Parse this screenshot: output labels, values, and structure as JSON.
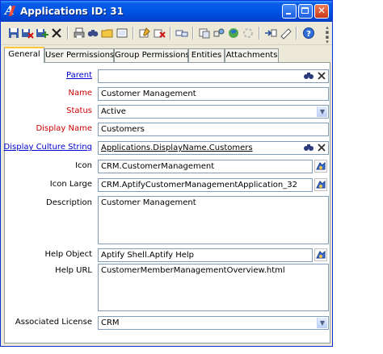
{
  "window": {
    "title": "Applications ID: 31"
  },
  "title_buttons": {
    "minimize": "minimize-button",
    "maximize": "maximize-button",
    "close": "close-button"
  },
  "toolbar": {
    "icons": [
      "save-icon",
      "save-and-close-icon",
      "save-and-new-icon",
      "delete-icon",
      "print-icon",
      "find-icon",
      "open-folder-icon",
      "copy-icon",
      "note-icon",
      "clear-icon",
      "link-icon",
      "attach-icon",
      "workflow-icon",
      "web-icon",
      "spinner-icon",
      "import-icon",
      "export-icon",
      "help-icon",
      "grip-icon"
    ]
  },
  "tabs": [
    {
      "label": "General",
      "active": true
    },
    {
      "label": "User Permissions",
      "active": false
    },
    {
      "label": "Group Permissions",
      "active": false
    },
    {
      "label": "Entities",
      "active": false
    },
    {
      "label": "Attachments",
      "active": false
    }
  ],
  "form": {
    "parent": {
      "label": "Parent",
      "value": ""
    },
    "name": {
      "label": "Name",
      "value": "Customer Management"
    },
    "status": {
      "label": "Status",
      "value": "Active"
    },
    "display_name": {
      "label": "Display Name",
      "value": "Customers"
    },
    "display_culture_string": {
      "label": "Display Culture String",
      "value": "Applications.DisplayName.Customers"
    },
    "icon": {
      "label": "Icon",
      "value": "CRM.CustomerManagement"
    },
    "icon_large": {
      "label": "Icon Large",
      "value": "CRM.AptifyCustomerManagementApplication_32"
    },
    "description": {
      "label": "Description",
      "value": "Customer Management"
    },
    "help_object": {
      "label": "Help Object",
      "value": "Aptify Shell.Aptify Help"
    },
    "help_url": {
      "label": "Help URL",
      "value": "CustomerMemberManagementOverview.html"
    },
    "associated_license": {
      "label": "Associated License",
      "value": "CRM"
    }
  },
  "colors": {
    "title_bar": "#0055e5",
    "required_label": "#cc0000",
    "link_label": "#0000cc",
    "tab_highlight": "#ffc83c"
  }
}
